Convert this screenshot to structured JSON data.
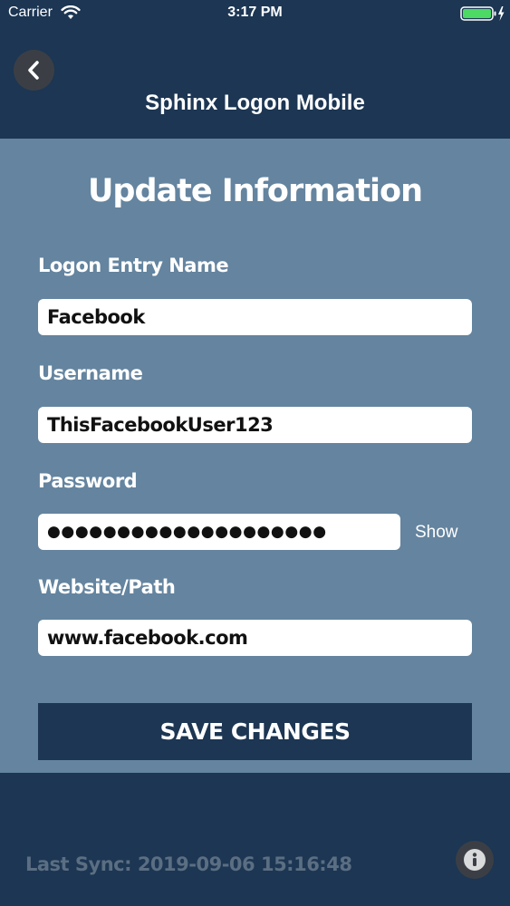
{
  "status_bar": {
    "carrier": "Carrier",
    "time": "3:17 PM",
    "icons": [
      "wifi-icon",
      "battery-icon",
      "charging-bolt-icon"
    ],
    "battery_color": "#4cd964"
  },
  "nav": {
    "title": "Sphinx Logon Mobile",
    "back_icon": "chevron-left-icon"
  },
  "form": {
    "title": "Update Information",
    "fields": [
      {
        "label": "Logon Entry Name",
        "value": "Facebook"
      },
      {
        "label": "Username",
        "value": "ThisFacebookUser123"
      },
      {
        "label": "Password",
        "value": "●●●●●●●●●●●●●●●●●●●●",
        "show_label": "Show"
      },
      {
        "label": "Website/Path",
        "value": "www.facebook.com"
      }
    ],
    "save_label": "SAVE CHANGES"
  },
  "footer": {
    "last_sync": "Last Sync: 2019-09-06 15:16:48",
    "info_icon": "info-icon"
  },
  "colors": {
    "navy": "#1c3653",
    "content_bg": "#64849f",
    "field_bg": "#ffffff",
    "circle_button_bg": "#3b3f45",
    "sync_text": "#5b6e82"
  }
}
